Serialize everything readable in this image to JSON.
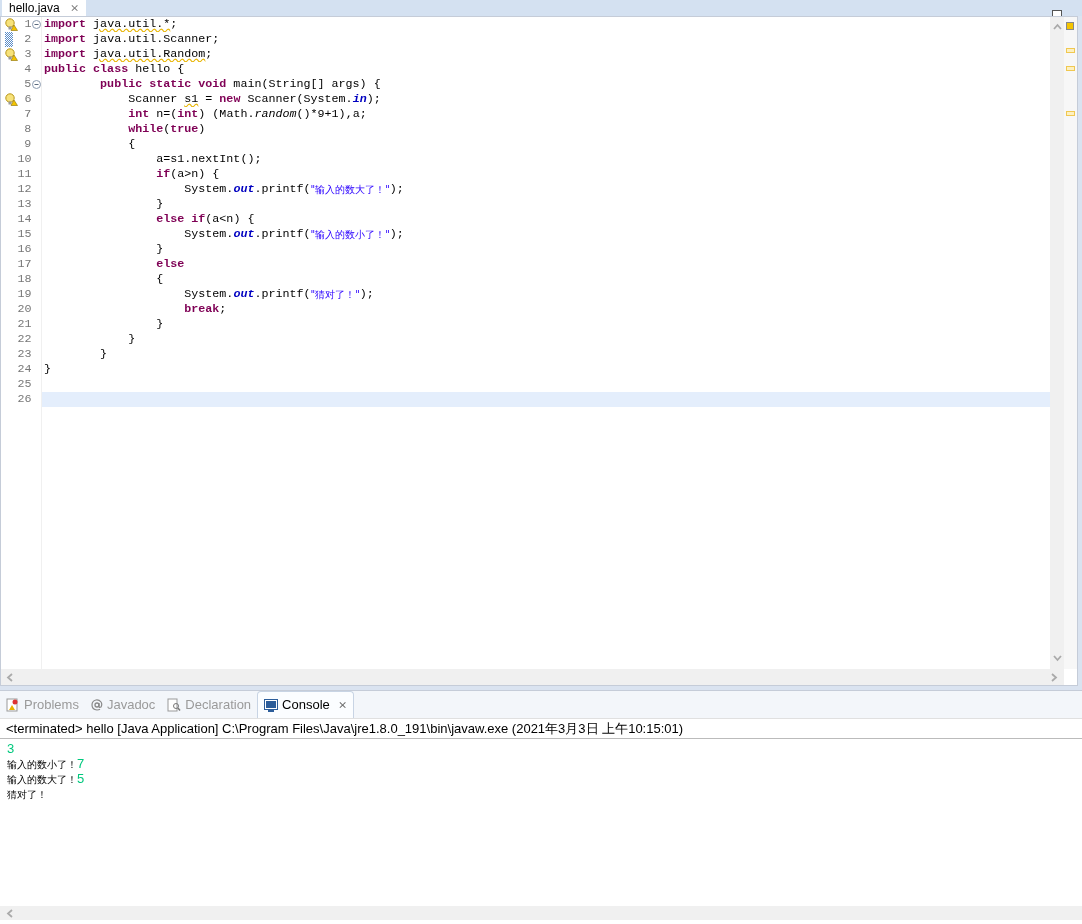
{
  "editor": {
    "tab": {
      "title": "hello.java",
      "close": "⨯"
    },
    "lines": [
      {
        "number": "1",
        "kind": "warning",
        "fold": true,
        "current": false,
        "segments": [
          {
            "kind": "keyword",
            "text": "import "
          },
          {
            "kind": "warned",
            "text": "java.util.*"
          },
          {
            "kind": "plain",
            "text": ";"
          }
        ]
      },
      {
        "number": "2",
        "kind": "occurrence",
        "fold": false,
        "current": false,
        "segments": [
          {
            "kind": "keyword",
            "text": "import"
          },
          {
            "kind": "plain",
            "text": " java.util.Scanner;"
          }
        ]
      },
      {
        "number": "3",
        "kind": "warning",
        "fold": false,
        "current": false,
        "segments": [
          {
            "kind": "keyword",
            "text": "import "
          },
          {
            "kind": "warned",
            "text": "java.util.Random"
          },
          {
            "kind": "plain",
            "text": ";"
          }
        ]
      },
      {
        "number": "4",
        "fold": false,
        "current": false,
        "segments": [
          {
            "kind": "keyword",
            "text": "public class"
          },
          {
            "kind": "plain",
            "text": " hello {"
          }
        ]
      },
      {
        "number": "5",
        "fold": true,
        "current": false,
        "segments": [
          {
            "kind": "keyword",
            "text": "        public static void"
          },
          {
            "kind": "plain",
            "text": " main(String[] args) {"
          }
        ]
      },
      {
        "number": "6",
        "kind": "warning",
        "fold": false,
        "current": false,
        "segments": [
          {
            "kind": "plain",
            "text": "            Scanner "
          },
          {
            "kind": "warned",
            "text": "s1"
          },
          {
            "kind": "plain",
            "text": " = "
          },
          {
            "kind": "keyword",
            "text": "new"
          },
          {
            "kind": "plain",
            "text": " Scanner(System."
          },
          {
            "kind": "field",
            "text": "in"
          },
          {
            "kind": "plain",
            "text": ");"
          }
        ]
      },
      {
        "number": "7",
        "fold": false,
        "current": false,
        "segments": [
          {
            "kind": "keyword",
            "text": "            int"
          },
          {
            "kind": "plain",
            "text": " n=("
          },
          {
            "kind": "keyword",
            "text": "int"
          },
          {
            "kind": "plain",
            "text": ") (Math."
          },
          {
            "kind": "method",
            "text": "random"
          },
          {
            "kind": "plain",
            "text": "()*9+1),a;"
          }
        ]
      },
      {
        "number": "8",
        "fold": false,
        "current": false,
        "segments": [
          {
            "kind": "keyword",
            "text": "            while"
          },
          {
            "kind": "plain",
            "text": "("
          },
          {
            "kind": "keyword",
            "text": "true"
          },
          {
            "kind": "plain",
            "text": ")"
          }
        ]
      },
      {
        "number": "9",
        "fold": false,
        "current": false,
        "segments": [
          {
            "kind": "plain",
            "text": "            {"
          }
        ]
      },
      {
        "number": "10",
        "fold": false,
        "current": false,
        "segments": [
          {
            "kind": "plain",
            "text": "                a=s1.nextInt();"
          }
        ]
      },
      {
        "number": "11",
        "fold": false,
        "current": false,
        "segments": [
          {
            "kind": "keyword",
            "text": "                if"
          },
          {
            "kind": "plain",
            "text": "(a>n) {"
          }
        ]
      },
      {
        "number": "12",
        "fold": false,
        "current": false,
        "segments": [
          {
            "kind": "plain",
            "text": "                    System."
          },
          {
            "kind": "field",
            "text": "out"
          },
          {
            "kind": "plain",
            "text": ".printf("
          },
          {
            "kind": "string",
            "text": "\"输入的数大了！\""
          },
          {
            "kind": "plain",
            "text": ");"
          }
        ]
      },
      {
        "number": "13",
        "fold": false,
        "current": false,
        "segments": [
          {
            "kind": "plain",
            "text": "                }"
          }
        ]
      },
      {
        "number": "14",
        "fold": false,
        "current": false,
        "segments": [
          {
            "kind": "keyword",
            "text": "                else if"
          },
          {
            "kind": "plain",
            "text": "(a<n) {"
          }
        ]
      },
      {
        "number": "15",
        "fold": false,
        "current": false,
        "segments": [
          {
            "kind": "plain",
            "text": "                    System."
          },
          {
            "kind": "field",
            "text": "out"
          },
          {
            "kind": "plain",
            "text": ".printf("
          },
          {
            "kind": "string",
            "text": "\"输入的数小了！\""
          },
          {
            "kind": "plain",
            "text": ");"
          }
        ]
      },
      {
        "number": "16",
        "fold": false,
        "current": false,
        "segments": [
          {
            "kind": "plain",
            "text": "                }"
          }
        ]
      },
      {
        "number": "17",
        "fold": false,
        "current": false,
        "segments": [
          {
            "kind": "keyword",
            "text": "                else"
          }
        ]
      },
      {
        "number": "18",
        "fold": false,
        "current": false,
        "segments": [
          {
            "kind": "plain",
            "text": "                {"
          }
        ]
      },
      {
        "number": "19",
        "fold": false,
        "current": false,
        "segments": [
          {
            "kind": "plain",
            "text": "                    System."
          },
          {
            "kind": "field",
            "text": "out"
          },
          {
            "kind": "plain",
            "text": ".printf("
          },
          {
            "kind": "string",
            "text": "\"猜对了！\""
          },
          {
            "kind": "plain",
            "text": ");"
          }
        ]
      },
      {
        "number": "20",
        "fold": false,
        "current": false,
        "segments": [
          {
            "kind": "keyword",
            "text": "                    break"
          },
          {
            "kind": "plain",
            "text": ";"
          }
        ]
      },
      {
        "number": "21",
        "fold": false,
        "current": false,
        "segments": [
          {
            "kind": "plain",
            "text": "                }"
          }
        ]
      },
      {
        "number": "22",
        "fold": false,
        "current": false,
        "segments": [
          {
            "kind": "plain",
            "text": "            }"
          }
        ]
      },
      {
        "number": "23",
        "fold": false,
        "current": false,
        "segments": [
          {
            "kind": "plain",
            "text": "        }"
          }
        ]
      },
      {
        "number": "24",
        "fold": false,
        "current": false,
        "segments": [
          {
            "kind": "plain",
            "text": "}"
          }
        ]
      },
      {
        "number": "25",
        "fold": false,
        "current": false
      },
      {
        "number": "26",
        "fold": false,
        "current": true
      }
    ]
  },
  "console": {
    "tabs": [
      {
        "label": "Problems",
        "kind": "problems",
        "selected": false
      },
      {
        "label": "Javadoc",
        "kind": "javadoc",
        "selected": false
      },
      {
        "label": "Declaration",
        "kind": "declaration",
        "selected": false
      },
      {
        "label": "Console",
        "kind": "console",
        "selected": true,
        "close": "⨯"
      }
    ],
    "header": "<terminated> hello [Java Application] C:\\Program Files\\Java\\jre1.8.0_191\\bin\\javaw.exe (2021年3月3日 上午10:15:01)",
    "output": [
      [
        {
          "kind": "input",
          "text": "3"
        }
      ],
      [
        {
          "kind": "output",
          "text": "输入的数小了！"
        },
        {
          "kind": "input",
          "text": "7"
        }
      ],
      [
        {
          "kind": "output",
          "text": "输入的数大了！"
        },
        {
          "kind": "input",
          "text": "5"
        }
      ],
      [
        {
          "kind": "output",
          "text": "猜对了！"
        }
      ]
    ]
  }
}
